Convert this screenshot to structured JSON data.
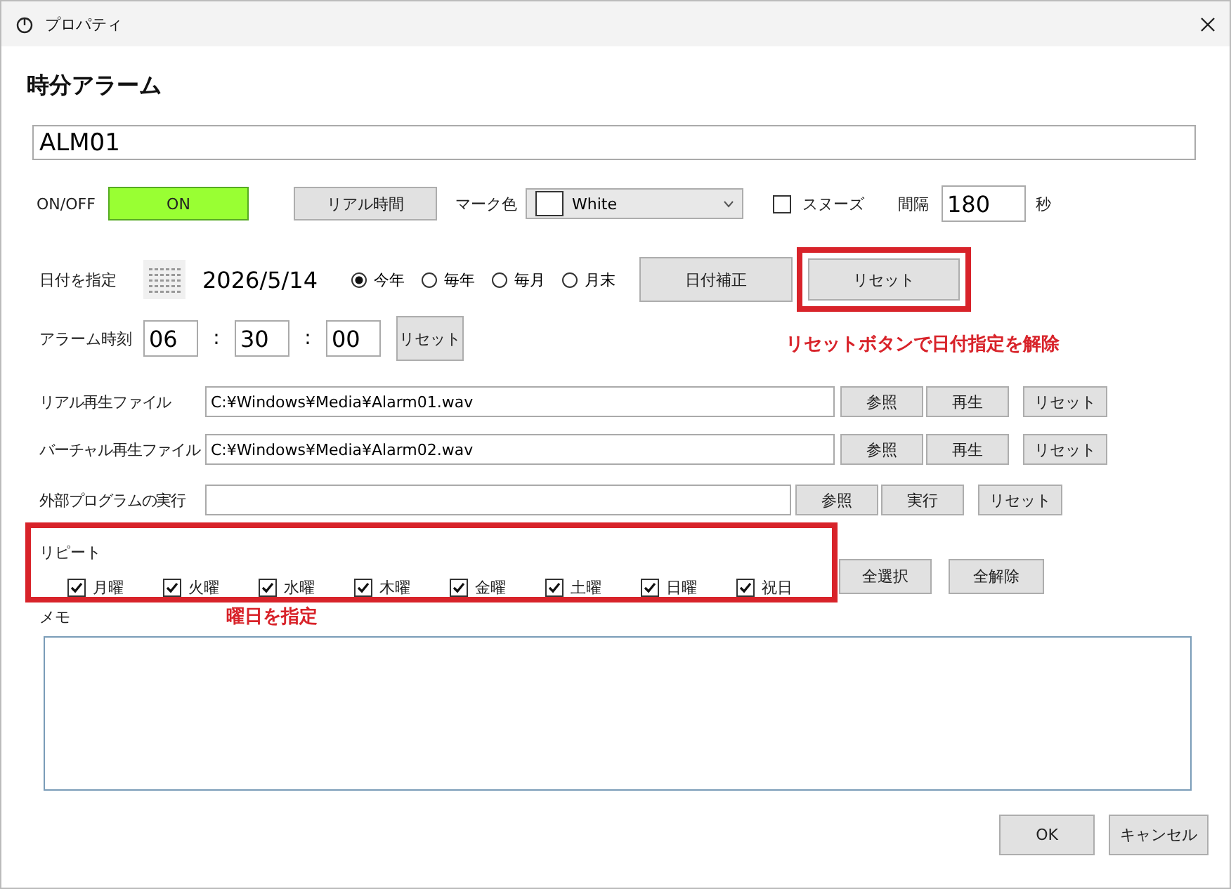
{
  "window": {
    "title": "プロパティ"
  },
  "heading": "時分アラーム",
  "name_field": {
    "value": "ALM01"
  },
  "onoff": {
    "label": "ON/OFF",
    "button": "ON",
    "on": true
  },
  "real_time_button": "リアル時間",
  "mark_color": {
    "label": "マーク色",
    "value": "White"
  },
  "snooze": {
    "label": "スヌーズ",
    "checked": false
  },
  "interval": {
    "label": "間隔",
    "value": "180",
    "unit": "秒"
  },
  "date": {
    "label": "日付を指定",
    "value": "2026/5/14",
    "options": [
      {
        "label": "今年",
        "selected": true
      },
      {
        "label": "毎年",
        "selected": false
      },
      {
        "label": "毎月",
        "selected": false
      },
      {
        "label": "月末",
        "selected": false
      }
    ],
    "adjust_button": "日付補正",
    "reset_button": "リセット"
  },
  "alarm_time": {
    "label": "アラーム時刻",
    "hour": "06",
    "minute": "30",
    "second": "00",
    "separator": ":",
    "reset_button": "リセット"
  },
  "files": [
    {
      "label": "リアル再生ファイル",
      "value": "C:¥Windows¥Media¥Alarm01.wav",
      "buttons": [
        "参照",
        "再生",
        "リセット"
      ]
    },
    {
      "label": "バーチャル再生ファイル",
      "value": "C:¥Windows¥Media¥Alarm02.wav",
      "buttons": [
        "参照",
        "再生",
        "リセット"
      ]
    },
    {
      "label": "外部プログラムの実行",
      "buttons": [
        "参照",
        "実行",
        "リセット"
      ]
    }
  ],
  "repeat": {
    "label": "リピート",
    "days": [
      {
        "label": "月曜",
        "checked": true
      },
      {
        "label": "火曜",
        "checked": true
      },
      {
        "label": "水曜",
        "checked": true
      },
      {
        "label": "木曜",
        "checked": true
      },
      {
        "label": "金曜",
        "checked": true
      },
      {
        "label": "土曜",
        "checked": true
      },
      {
        "label": "日曜",
        "checked": true
      },
      {
        "label": "祝日",
        "checked": true
      }
    ],
    "select_all": "全選択",
    "clear_all": "全解除"
  },
  "memo": {
    "label": "メモ"
  },
  "annotations": [
    "リセットボタンで日付指定を解除",
    "曜日を指定"
  ],
  "footer": {
    "ok": "OK",
    "cancel": "キャンセル"
  }
}
